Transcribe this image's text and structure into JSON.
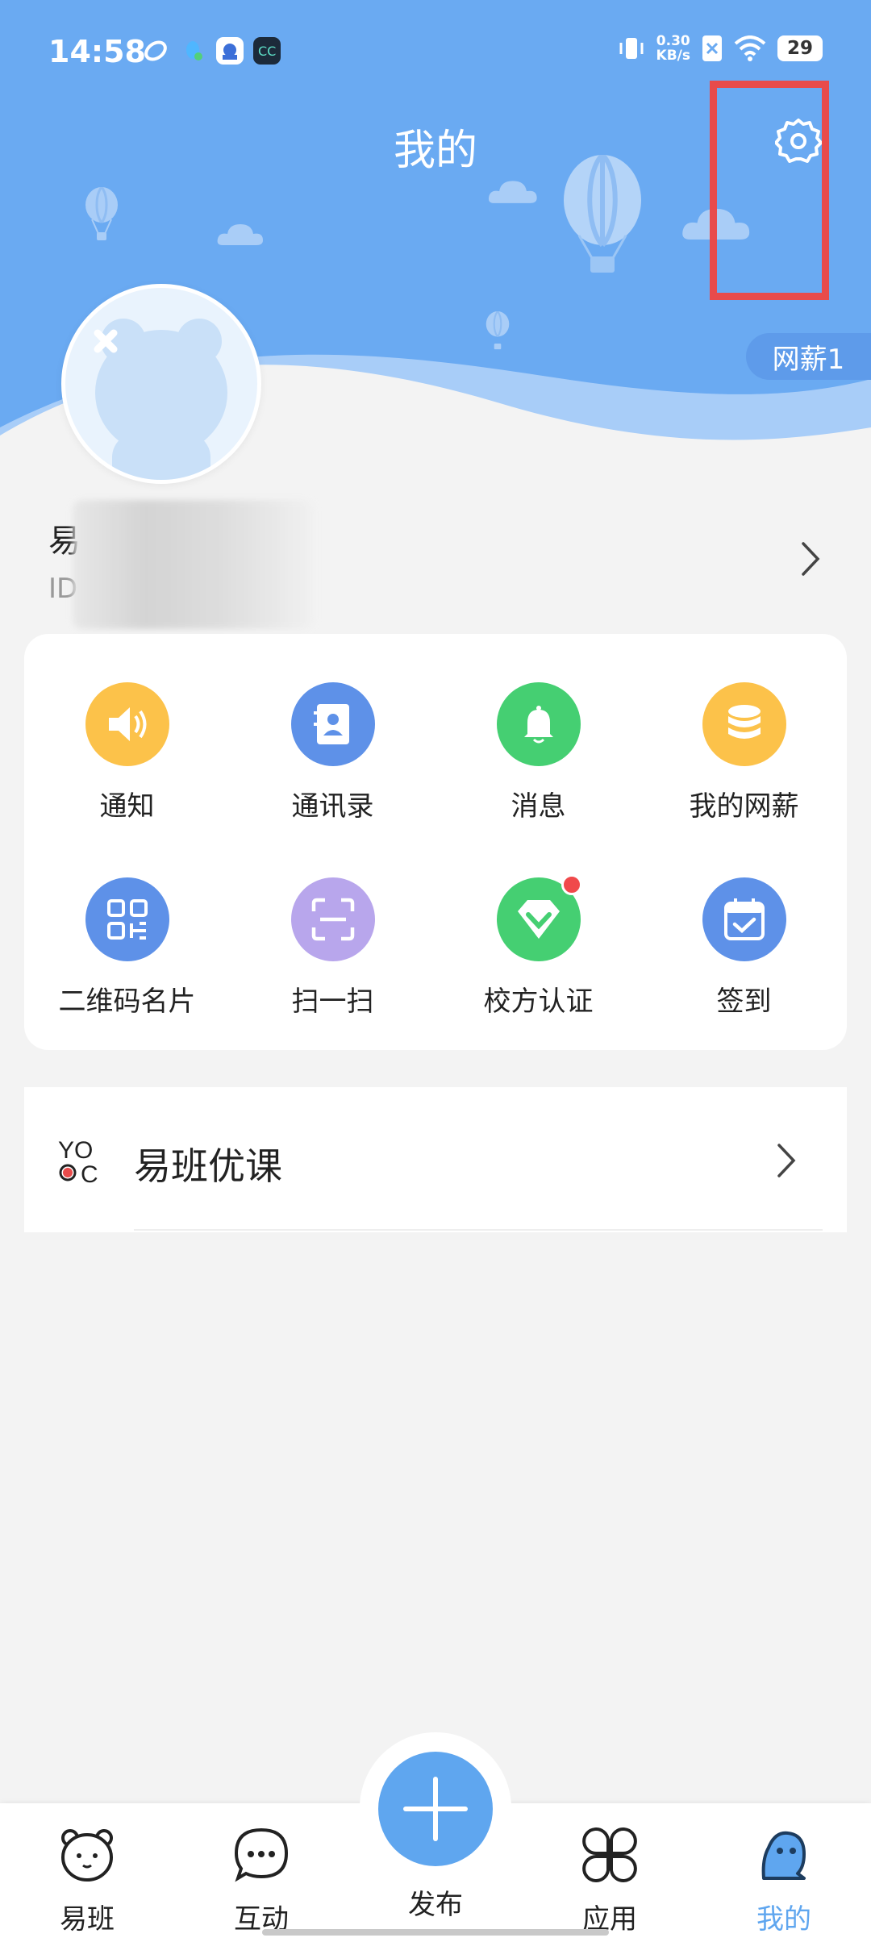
{
  "status_bar": {
    "time": "14:58",
    "speed_value": "0.30",
    "speed_unit": "KB/s",
    "battery": "29"
  },
  "header": {
    "title": "我的",
    "salary_badge": "网薪1"
  },
  "profile": {
    "name_visible": "易",
    "id_prefix": "ID"
  },
  "grid": [
    {
      "label": "通知",
      "icon": "speaker-icon",
      "color": "#fcc24a"
    },
    {
      "label": "通讯录",
      "icon": "contacts-book-icon",
      "color": "#5e91e8"
    },
    {
      "label": "消息",
      "icon": "bell-icon",
      "color": "#45cf72"
    },
    {
      "label": "我的网薪",
      "icon": "coin-stack-icon",
      "color": "#fcc24a"
    },
    {
      "label": "二维码名片",
      "icon": "qr-code-icon",
      "color": "#5e91e8"
    },
    {
      "label": "扫一扫",
      "icon": "scan-icon",
      "color": "#b8a6ec"
    },
    {
      "label": "校方认证",
      "icon": "verified-diamond-icon",
      "color": "#45cf72"
    },
    {
      "label": "签到",
      "icon": "calendar-check-icon",
      "color": "#5e91e8"
    }
  ],
  "course": {
    "logo_text_top": "YO",
    "logo_text_bottom": "C",
    "title": "易班优课"
  },
  "bottom_nav": [
    {
      "label": "易班",
      "icon": "bear-face-icon"
    },
    {
      "label": "互动",
      "icon": "chat-bubble-icon"
    },
    {
      "label": "发布",
      "icon": "plus-icon"
    },
    {
      "label": "应用",
      "icon": "apps-clover-icon"
    },
    {
      "label": "我的",
      "icon": "mascot-icon",
      "active": true
    }
  ],
  "colors": {
    "header_blue": "#6aaaf2",
    "accent": "#5fa6ef",
    "highlight_box": "#e84b4b"
  }
}
